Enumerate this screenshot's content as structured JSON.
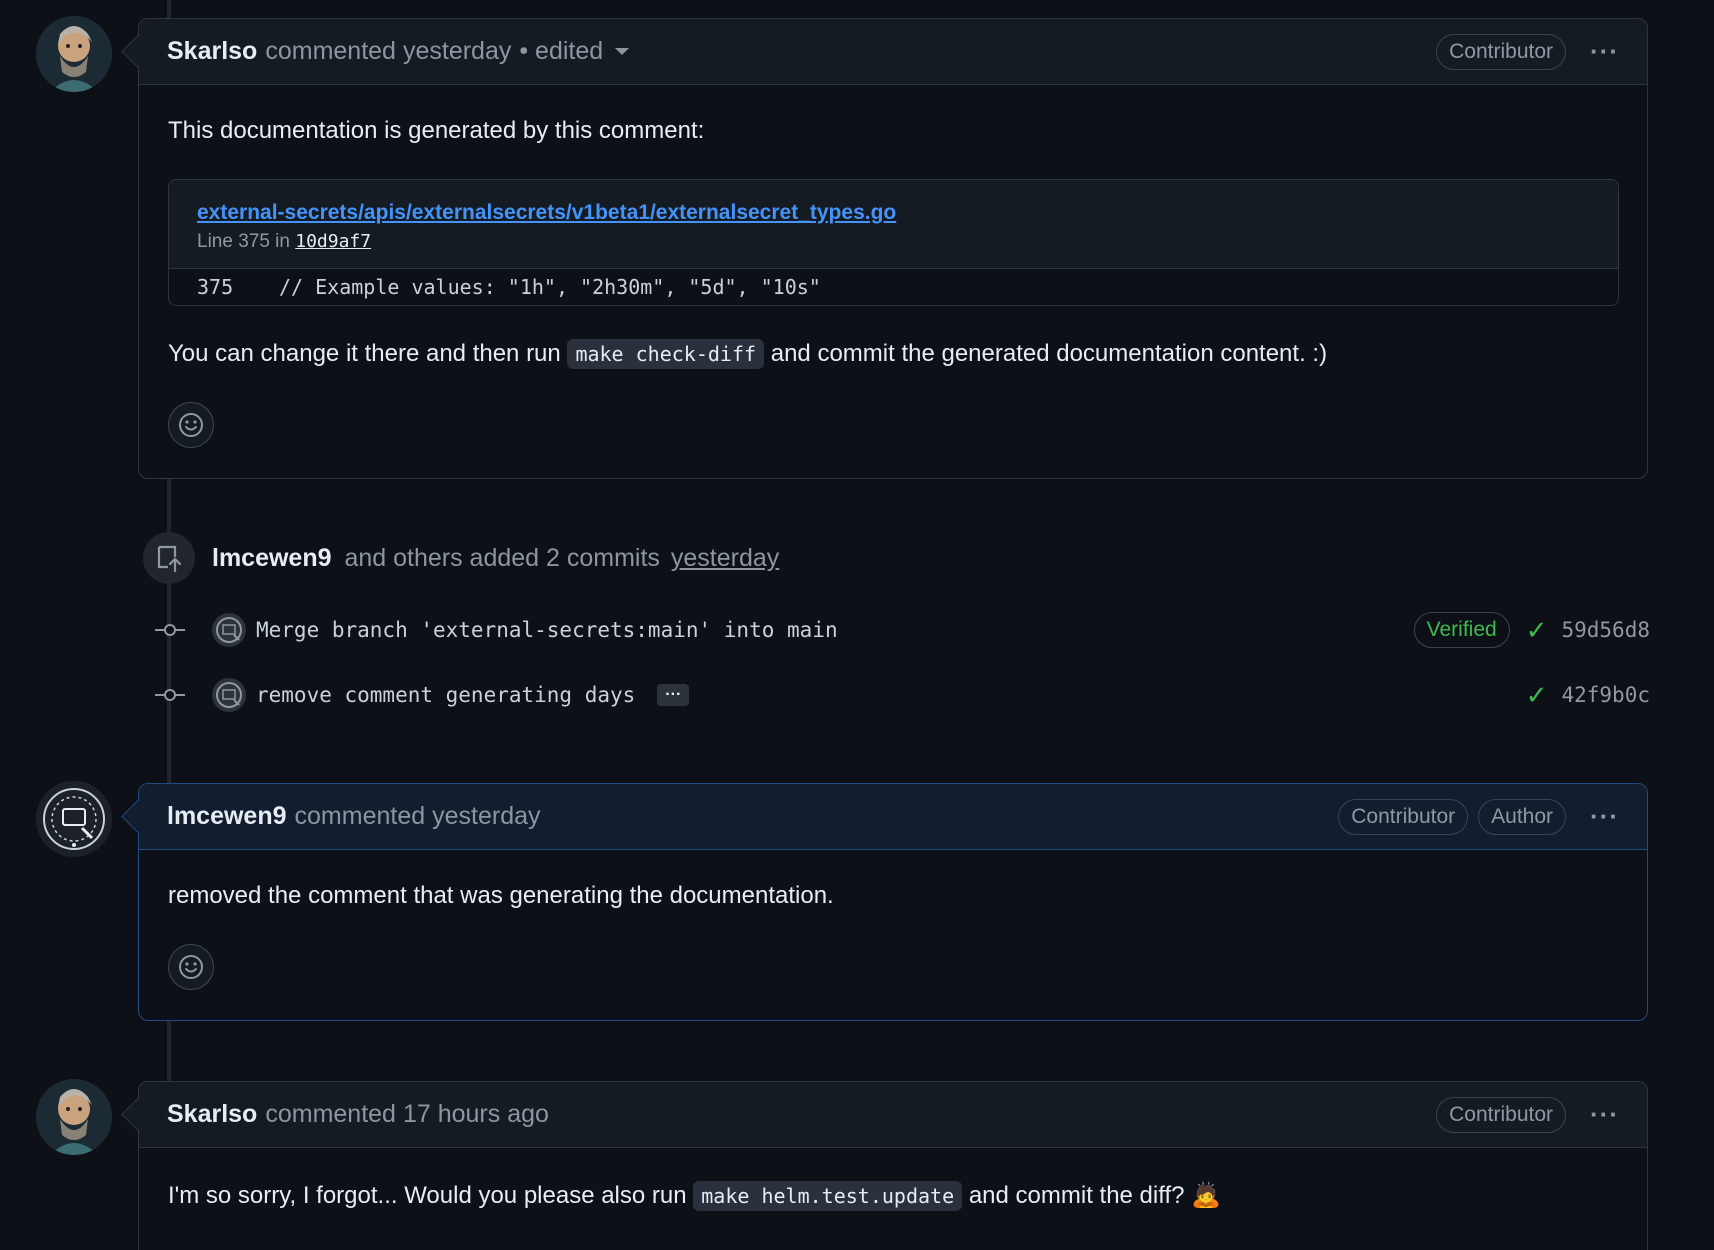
{
  "comments": [
    {
      "author": "Skarlso",
      "action": "commented",
      "time": "yesterday",
      "edited": "• edited",
      "labels": [
        "Contributor"
      ],
      "menu": "···",
      "intro": "This documentation is generated by this comment:",
      "permalink": {
        "path": "external-secrets/apis/externalsecrets/v1beta1/externalsecret_types.go",
        "line_prefix": "Line 375 in",
        "commit": "10d9af7",
        "line_number": "375",
        "code": "// Example values: \"1h\", \"2h30m\", \"5d\", \"10s\""
      },
      "outro_before": "You can change it there and then run",
      "outro_code": "make check-diff",
      "outro_after": "and commit the generated documentation content. :)"
    },
    {
      "author": "lmcewen9",
      "action": "commented",
      "time": "yesterday",
      "labels": [
        "Contributor",
        "Author"
      ],
      "menu": "···",
      "body": "removed the comment that was generating the documentation."
    },
    {
      "author": "Skarlso",
      "action": "commented",
      "time": "17 hours ago",
      "labels": [
        "Contributor"
      ],
      "menu": "···",
      "body_before": "I'm so sorry, I forgot... Would you please also run",
      "body_code": "make helm.test.update",
      "body_after": "and commit the diff? 🙇"
    }
  ],
  "push_event": {
    "actor": "lmcewen9",
    "text": "and others added 2 commits",
    "time": "yesterday",
    "commits": [
      {
        "message": "Merge branch 'external-secrets:main' into main",
        "verified": "Verified",
        "check": "✓",
        "sha": "59d56d8"
      },
      {
        "message": "remove comment generating days",
        "expand": "···",
        "check": "✓",
        "sha": "42f9b0c"
      }
    ]
  }
}
